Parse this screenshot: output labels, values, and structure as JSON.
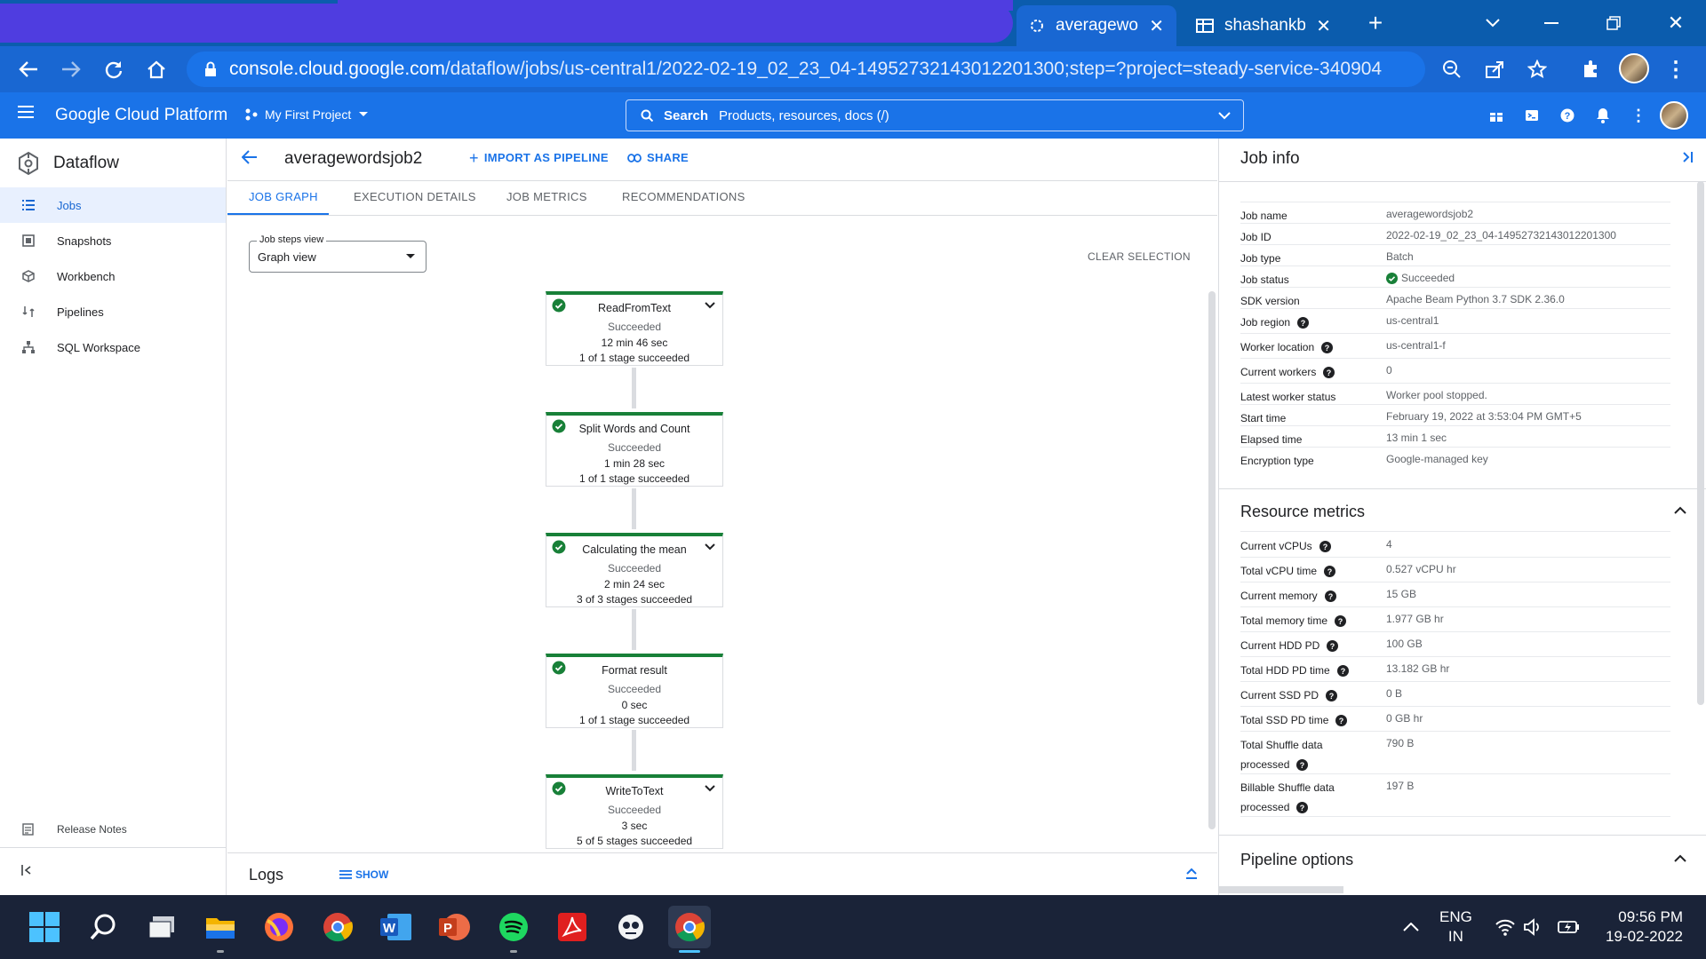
{
  "browser": {
    "tabs": [
      {
        "title": "averagewords",
        "active": true
      },
      {
        "title": "shashankbe",
        "active": false
      }
    ],
    "url_host": "console.cloud.google.com",
    "url_path": "/dataflow/jobs/us-central1/2022-02-19_02_23_04-14952732143012201300;step=?project=steady-service-340904"
  },
  "gcp_header": {
    "brand": "Google Cloud Platform",
    "project": "My First Project",
    "search_label": "Search",
    "search_placeholder": "Products, resources, docs (/)"
  },
  "sidebar": {
    "product": "Dataflow",
    "items": [
      {
        "label": "Jobs",
        "icon": "list-icon",
        "active": true
      },
      {
        "label": "Snapshots",
        "icon": "snapshot-icon",
        "active": false
      },
      {
        "label": "Workbench",
        "icon": "workbench-icon",
        "active": false
      },
      {
        "label": "Pipelines",
        "icon": "pipelines-icon",
        "active": false
      },
      {
        "label": "SQL Workspace",
        "icon": "sql-icon",
        "active": false
      }
    ],
    "release_notes": "Release Notes"
  },
  "job": {
    "name": "averagewordsjob2",
    "actions": {
      "import": "IMPORT AS PIPELINE",
      "share": "SHARE"
    },
    "tabs": [
      "JOB GRAPH",
      "EXECUTION DETAILS",
      "JOB METRICS",
      "RECOMMENDATIONS"
    ],
    "steps_view_label": "Job steps view",
    "steps_view_value": "Graph view",
    "clear_selection": "CLEAR SELECTION"
  },
  "graph": {
    "nodes": [
      {
        "name": "ReadFromText",
        "status": "Succeeded",
        "time": "12 min 46 sec",
        "stages": "1 of 1 stage succeeded",
        "expandable": true
      },
      {
        "name": "Split Words and Count",
        "status": "Succeeded",
        "time": "1 min 28 sec",
        "stages": "1 of 1 stage succeeded",
        "expandable": false
      },
      {
        "name": "Calculating the mean",
        "status": "Succeeded",
        "time": "2 min 24 sec",
        "stages": "3 of 3 stages succeeded",
        "expandable": true
      },
      {
        "name": "Format result",
        "status": "Succeeded",
        "time": "0 sec",
        "stages": "1 of 1 stage succeeded",
        "expandable": false
      },
      {
        "name": "WriteToText",
        "status": "Succeeded",
        "time": "3 sec",
        "stages": "5 of 5 stages succeeded",
        "expandable": true
      }
    ]
  },
  "logs": {
    "title": "Logs",
    "show": "SHOW"
  },
  "job_info": {
    "title": "Job info",
    "rows": [
      {
        "key": "Job name",
        "value": "averagewordsjob2"
      },
      {
        "key": "Job ID",
        "value": "2022-02-19_02_23_04-14952732143012201300"
      },
      {
        "key": "Job type",
        "value": "Batch"
      },
      {
        "key": "Job status",
        "value": "Succeeded"
      },
      {
        "key": "SDK version",
        "value": "Apache Beam Python 3.7 SDK 2.36.0"
      },
      {
        "key": "Job region",
        "value": "us-central1"
      },
      {
        "key": "Worker location",
        "value": "us-central1-f"
      },
      {
        "key": "Current workers",
        "value": "0"
      },
      {
        "key": "Latest worker status",
        "value": "Worker pool stopped."
      },
      {
        "key": "Start time",
        "value": "February 19, 2022 at 3:53:04 PM GMT+5"
      },
      {
        "key": "Elapsed time",
        "value": "13 min 1 sec"
      },
      {
        "key": "Encryption type",
        "value": "Google-managed key"
      }
    ],
    "resource_title": "Resource metrics",
    "resource_rows": [
      {
        "key": "Current vCPUs",
        "value": "4"
      },
      {
        "key": "Total vCPU time",
        "value": "0.527 vCPU hr"
      },
      {
        "key": "Current memory",
        "value": "15 GB"
      },
      {
        "key": "Total memory time",
        "value": "1.977 GB hr"
      },
      {
        "key": "Current HDD PD",
        "value": "100 GB"
      },
      {
        "key": "Total HDD PD time",
        "value": "13.182 GB hr"
      },
      {
        "key": "Current SSD PD",
        "value": "0 B"
      },
      {
        "key": "Total SSD PD time",
        "value": "0 GB hr"
      },
      {
        "key": "Total Shuffle data processed",
        "value": "790 B"
      },
      {
        "key": "Billable Shuffle data processed",
        "value": "197 B"
      }
    ],
    "pipeline_title": "Pipeline options"
  },
  "taskbar": {
    "lang": "ENG",
    "region": "IN",
    "time": "09:56 PM",
    "date": "19-02-2022"
  },
  "colors": {
    "accent": "#1a73e8",
    "success": "#188038"
  }
}
